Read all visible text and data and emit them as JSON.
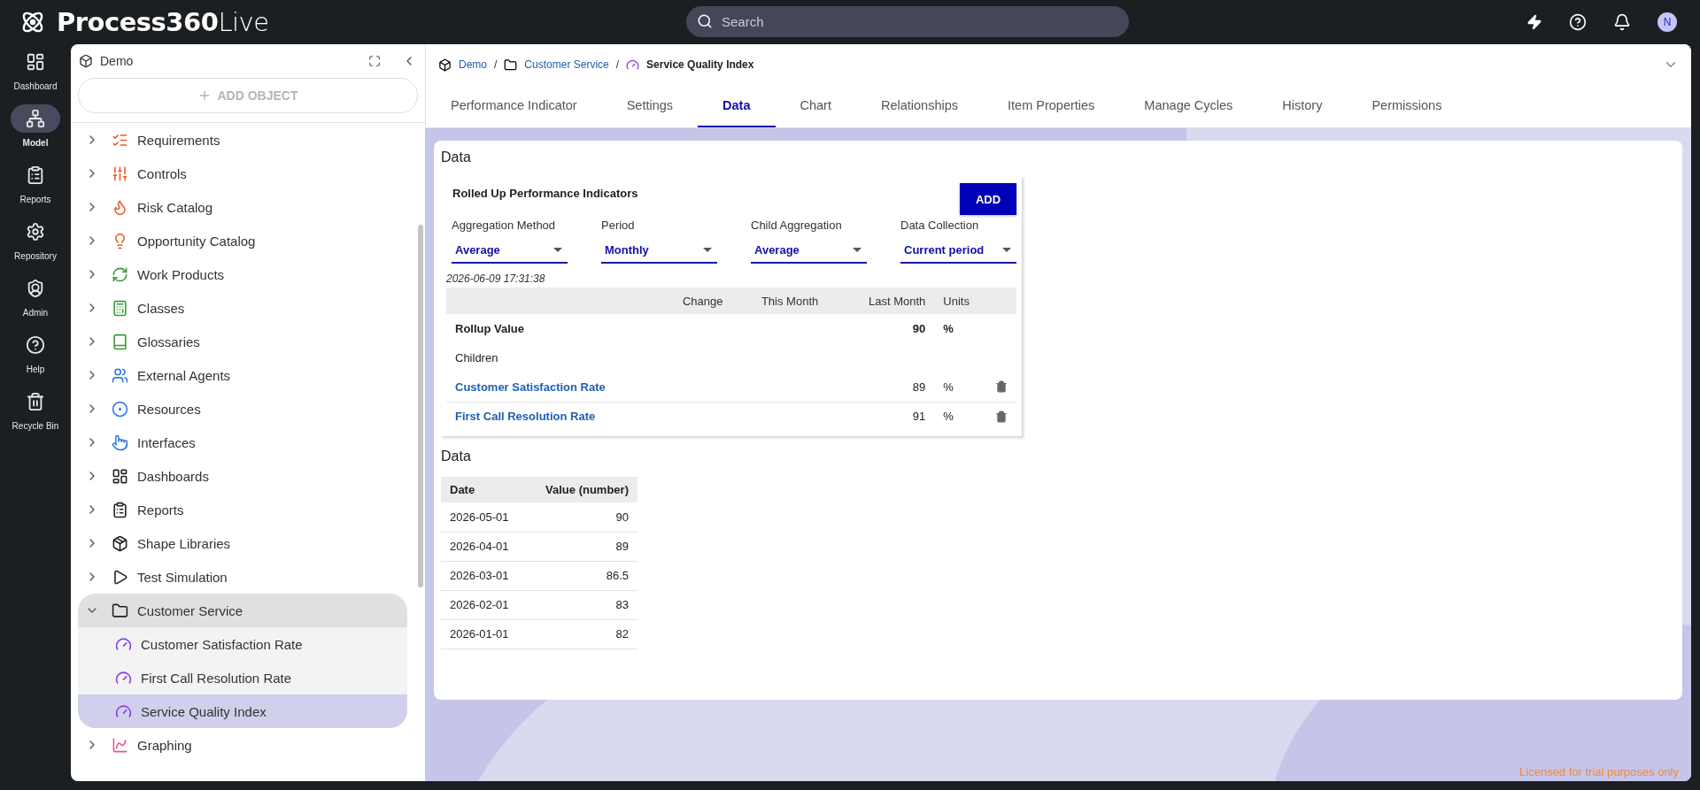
{
  "app": {
    "logo_bold": "Process360",
    "logo_light": "Live",
    "search_placeholder": "Search",
    "avatar": "N"
  },
  "rail": [
    {
      "label": "Dashboard",
      "selected": false
    },
    {
      "label": "Model",
      "selected": true
    },
    {
      "label": "Reports",
      "selected": false
    },
    {
      "label": "Repository",
      "selected": false
    },
    {
      "label": "Admin",
      "selected": false
    },
    {
      "label": "Help",
      "selected": false
    },
    {
      "label": "Recycle Bin",
      "selected": false
    }
  ],
  "sidebar": {
    "title": "Demo",
    "add_button": "ADD OBJECT",
    "items": [
      {
        "label": "Requirements",
        "expanded": false,
        "selected": false
      },
      {
        "label": "Controls",
        "expanded": false,
        "selected": false
      },
      {
        "label": "Risk Catalog",
        "expanded": false,
        "selected": false
      },
      {
        "label": "Opportunity Catalog",
        "expanded": false,
        "selected": false
      },
      {
        "label": "Work Products",
        "expanded": false,
        "selected": false
      },
      {
        "label": "Classes",
        "expanded": false,
        "selected": false
      },
      {
        "label": "Glossaries",
        "expanded": false,
        "selected": false
      },
      {
        "label": "External Agents",
        "expanded": false,
        "selected": false
      },
      {
        "label": "Resources",
        "expanded": false,
        "selected": false
      },
      {
        "label": "Interfaces",
        "expanded": false,
        "selected": false
      },
      {
        "label": "Dashboards",
        "expanded": false,
        "selected": false
      },
      {
        "label": "Reports",
        "expanded": false,
        "selected": false
      },
      {
        "label": "Shape Libraries",
        "expanded": false,
        "selected": false
      },
      {
        "label": "Test Simulation",
        "expanded": false,
        "selected": false
      },
      {
        "label": "Customer Service",
        "expanded": true,
        "selected": false,
        "children": [
          {
            "label": "Customer Satisfaction Rate",
            "selected": false
          },
          {
            "label": "First Call Resolution Rate",
            "selected": false
          },
          {
            "label": "Service Quality Index",
            "selected": true
          }
        ]
      },
      {
        "label": "Graphing",
        "expanded": false,
        "selected": false
      }
    ]
  },
  "breadcrumb": [
    {
      "label": "Demo",
      "separator": "/"
    },
    {
      "label": "Customer Service",
      "separator": "/"
    },
    {
      "label": "Service Quality Index"
    }
  ],
  "tabs": [
    {
      "label": "Performance Indicator",
      "selected": false
    },
    {
      "label": "Settings",
      "selected": false
    },
    {
      "label": "Data",
      "selected": true
    },
    {
      "label": "Chart",
      "selected": false
    },
    {
      "label": "Relationships",
      "selected": false
    },
    {
      "label": "Item Properties",
      "selected": false
    },
    {
      "label": "Manage Cycles",
      "selected": false
    },
    {
      "label": "History",
      "selected": false
    },
    {
      "label": "Permissions",
      "selected": false
    }
  ],
  "data_section": {
    "title": "Data",
    "rollup": {
      "title": "Rolled Up Performance Indicators",
      "add_button": "ADD",
      "selects": [
        {
          "label": "Aggregation Method",
          "value": "Average"
        },
        {
          "label": "Period",
          "value": "Monthly"
        },
        {
          "label": "Child Aggregation",
          "value": "Average"
        },
        {
          "label": "Data Collection",
          "value": "Current period"
        }
      ],
      "timestamp": "2026-06-09 17:31:38",
      "columns": [
        "Change",
        "This Month",
        "Last Month",
        "Units"
      ],
      "rollup_row": {
        "label": "Rollup Value",
        "last_month": "90",
        "units": "%"
      },
      "children_label": "Children",
      "children": [
        {
          "name": "Customer Satisfaction Rate",
          "last_month": "89",
          "units": "%"
        },
        {
          "name": "First Call Resolution Rate",
          "last_month": "91",
          "units": "%"
        }
      ]
    },
    "values_title": "Data",
    "values_table": {
      "columns": [
        "Date",
        "Value (number)"
      ],
      "rows": [
        [
          "2026-05-01",
          "90"
        ],
        [
          "2026-04-01",
          "89"
        ],
        [
          "2026-03-01",
          "86.5"
        ],
        [
          "2026-02-01",
          "83"
        ],
        [
          "2026-01-01",
          "82"
        ]
      ]
    }
  },
  "footer": "Licensed for trial purposes only"
}
